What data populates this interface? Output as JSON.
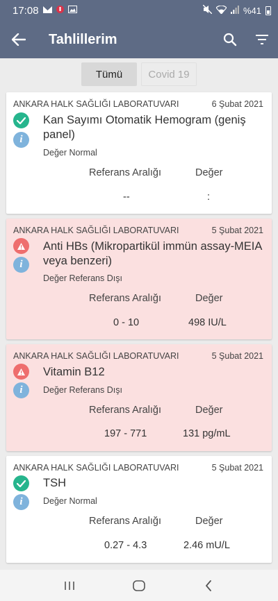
{
  "status_bar": {
    "time": "17:08",
    "battery": "%41",
    "icons": [
      "mail-icon",
      "shield-icon",
      "image-icon",
      "mute-icon",
      "wifi-icon",
      "signal-icon",
      "battery-icon"
    ]
  },
  "app_bar": {
    "title": "Tahlillerim",
    "back_icon": "arrow-left-icon",
    "search_icon": "search-icon",
    "filter_icon": "filter-icon"
  },
  "tabs": [
    {
      "label": "Tümü",
      "active": true
    },
    {
      "label": "Covid 19",
      "active": false
    }
  ],
  "columns": {
    "reference": "Referans Aralığı",
    "value": "Değer"
  },
  "results": [
    {
      "lab": "ANKARA HALK SAĞLIĞI LABORATUVARI",
      "date": "6 Şubat 2021",
      "name": "Kan Sayımı Otomatik Hemogram (geniş panel)",
      "status": "Değer Normal",
      "reference": "--",
      "value": ":",
      "abnormal": false
    },
    {
      "lab": "ANKARA HALK SAĞLIĞI LABORATUVARI",
      "date": "5 Şubat 2021",
      "name": "Anti HBs  (Mikropartikül immün assay-MEIA veya benzeri)",
      "status": "Değer Referans Dışı",
      "reference": "0 - 10",
      "value": "498 IU/L",
      "abnormal": true
    },
    {
      "lab": "ANKARA HALK SAĞLIĞI LABORATUVARI",
      "date": "5 Şubat 2021",
      "name": "Vitamin B12",
      "status": "Değer Referans Dışı",
      "reference": "197 - 771",
      "value": "131 pg/mL",
      "abnormal": true
    },
    {
      "lab": "ANKARA HALK SAĞLIĞI LABORATUVARI",
      "date": "5 Şubat 2021",
      "name": "TSH",
      "status": "Değer Normal",
      "reference": "0.27 - 4.3",
      "value": "2.46 mU/L",
      "abnormal": false
    }
  ],
  "colors": {
    "app_bar": "#5e6b85",
    "ok": "#26b58d",
    "warn": "#ee6e6e",
    "info": "#7fb3dc",
    "abnormal_card": "#fbe0e0"
  },
  "nav": [
    "recent-apps-icon",
    "home-icon",
    "back-icon"
  ]
}
